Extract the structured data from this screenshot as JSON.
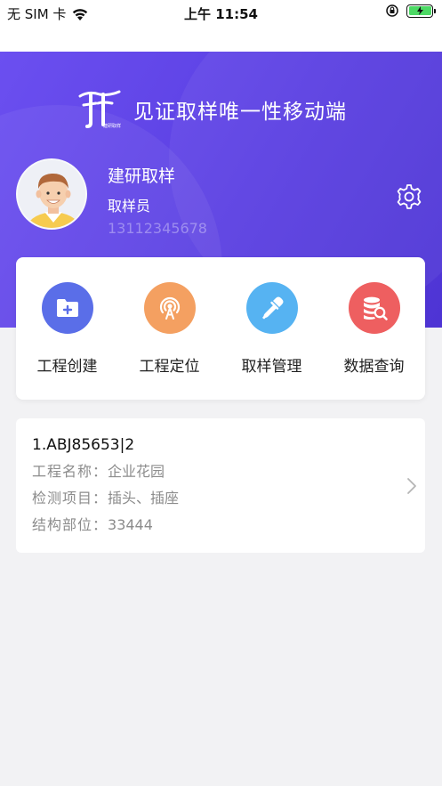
{
  "status_bar": {
    "carrier": "无 SIM 卡",
    "time": "上午 11:54"
  },
  "header": {
    "app_title": "见证取样唯一性移动端",
    "logo_subtext": "建研取样",
    "user": {
      "name": "建研取样",
      "role": "取样员",
      "phone": "13112345678"
    }
  },
  "actions": [
    {
      "label": "工程创建",
      "icon": "folder-plus-icon",
      "color": "#5a6ee8"
    },
    {
      "label": "工程定位",
      "icon": "location-signal-icon",
      "color": "#f4a061"
    },
    {
      "label": "取样管理",
      "icon": "dropper-icon",
      "color": "#56b3f2"
    },
    {
      "label": "数据查询",
      "icon": "database-search-icon",
      "color": "#ee5f60"
    }
  ],
  "records": [
    {
      "title": "1.ABJ85653|2",
      "project_label": "工程名称：",
      "project_value": "企业花园",
      "item_label": "检测项目：",
      "item_value": "插头、插座",
      "part_label": "结构部位：",
      "part_value": "33444"
    }
  ],
  "colors": {
    "header_start": "#6b4ff0",
    "header_end": "#4e34d4",
    "background": "#f2f2f4"
  }
}
